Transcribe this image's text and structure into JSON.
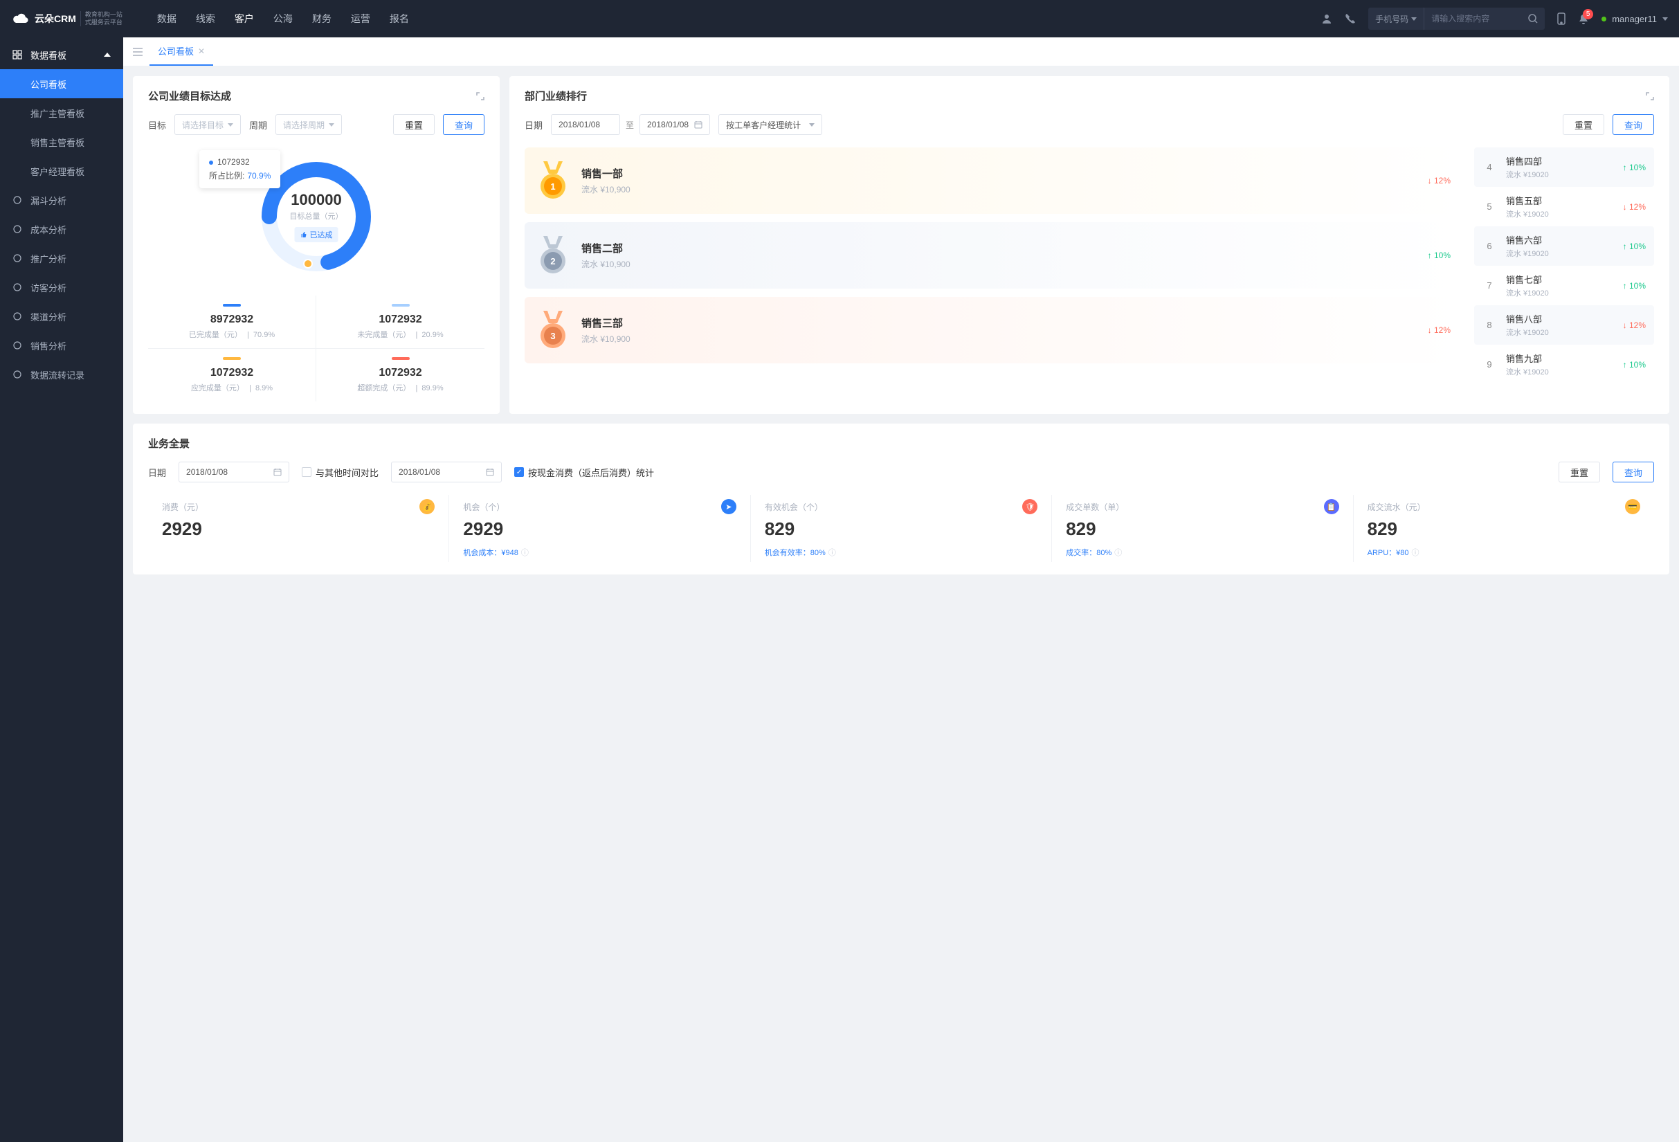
{
  "brand": {
    "name": "云朵CRM",
    "sub1": "教育机构一站",
    "sub2": "式服务云平台"
  },
  "nav": {
    "items": [
      "数据",
      "线索",
      "客户",
      "公海",
      "财务",
      "运营",
      "报名"
    ],
    "active_index": 2,
    "search_prefix": "手机号码",
    "search_placeholder": "请输入搜索内容",
    "notif_count": "5",
    "user": "manager11"
  },
  "sidebar": {
    "header": "数据看板",
    "subs": [
      "公司看板",
      "推广主管看板",
      "销售主管看板",
      "客户经理看板"
    ],
    "active_index": 0,
    "items": [
      "漏斗分析",
      "成本分析",
      "推广分析",
      "访客分析",
      "渠道分析",
      "销售分析",
      "数据流转记录"
    ]
  },
  "tab": {
    "title": "公司看板"
  },
  "goal": {
    "title": "公司业绩目标达成",
    "target_label": "目标",
    "target_placeholder": "请选择目标",
    "period_label": "周期",
    "period_placeholder": "请选择周期",
    "reset": "重置",
    "query": "查询",
    "tooltip_value": "1072932",
    "tooltip_ratio_label": "所占比例:",
    "tooltip_ratio": "70.9%",
    "center_num": "100000",
    "center_label": "目标总量（元）",
    "badge": "已达成",
    "metrics": [
      {
        "color": "#2d7ff9",
        "value": "8972932",
        "label": "已完成量（元）",
        "pct": "70.9%"
      },
      {
        "color": "#a6cfff",
        "value": "1072932",
        "label": "未完成量（元）",
        "pct": "20.9%"
      },
      {
        "color": "#ffb840",
        "value": "1072932",
        "label": "应完成量（元）",
        "pct": "8.9%"
      },
      {
        "color": "#ff6b5a",
        "value": "1072932",
        "label": "超额完成（元）",
        "pct": "89.9%"
      }
    ]
  },
  "ranking": {
    "title": "部门业绩排行",
    "date_label": "日期",
    "date_from": "2018/01/08",
    "date_to": "2018/01/08",
    "date_sep": "至",
    "stat_by": "按工单客户经理统计",
    "reset": "重置",
    "query": "查询",
    "top3": [
      {
        "name": "销售一部",
        "sub": "流水 ¥10,900",
        "trend": "down",
        "pct": "12%"
      },
      {
        "name": "销售二部",
        "sub": "流水 ¥10,900",
        "trend": "up",
        "pct": "10%"
      },
      {
        "name": "销售三部",
        "sub": "流水 ¥10,900",
        "trend": "down",
        "pct": "12%"
      }
    ],
    "rest": [
      {
        "idx": "4",
        "name": "销售四部",
        "sub": "流水 ¥19020",
        "trend": "up",
        "pct": "10%"
      },
      {
        "idx": "5",
        "name": "销售五部",
        "sub": "流水 ¥19020",
        "trend": "down",
        "pct": "12%"
      },
      {
        "idx": "6",
        "name": "销售六部",
        "sub": "流水 ¥19020",
        "trend": "up",
        "pct": "10%"
      },
      {
        "idx": "7",
        "name": "销售七部",
        "sub": "流水 ¥19020",
        "trend": "up",
        "pct": "10%"
      },
      {
        "idx": "8",
        "name": "销售八部",
        "sub": "流水 ¥19020",
        "trend": "down",
        "pct": "12%"
      },
      {
        "idx": "9",
        "name": "销售九部",
        "sub": "流水 ¥19020",
        "trend": "up",
        "pct": "10%"
      }
    ]
  },
  "overview": {
    "title": "业务全景",
    "date_label": "日期",
    "date1": "2018/01/08",
    "compare_label": "与其他时间对比",
    "date2": "2018/01/08",
    "consume_label": "按现金消费（返点后消费）统计",
    "reset": "重置",
    "query": "查询",
    "stats": [
      {
        "label": "消费（元）",
        "value": "2929",
        "foot": "",
        "color": "#ffb840"
      },
      {
        "label": "机会（个）",
        "value": "2929",
        "foot": "机会成本：¥948",
        "color": "#2d7ff9"
      },
      {
        "label": "有效机会（个）",
        "value": "829",
        "foot": "机会有效率：80%",
        "color": "#ff6b5a"
      },
      {
        "label": "成交单数（单）",
        "value": "829",
        "foot": "成交率：80%",
        "color": "#5b6cff"
      },
      {
        "label": "成交流水（元）",
        "value": "829",
        "foot": "ARPU：¥80",
        "color": "#ffb840"
      }
    ]
  },
  "chart_data": {
    "type": "pie",
    "title": "公司业绩目标达成",
    "total": 100000,
    "series": [
      {
        "name": "已完成量（元）",
        "value": 8972932,
        "pct": 70.9,
        "color": "#2d7ff9"
      },
      {
        "name": "未完成量（元）",
        "value": 1072932,
        "pct": 20.9,
        "color": "#a6cfff"
      },
      {
        "name": "应完成量（元）",
        "value": 1072932,
        "pct": 8.9,
        "color": "#ffb840"
      },
      {
        "name": "超额完成（元）",
        "value": 1072932,
        "pct": 89.9,
        "color": "#ff6b5a"
      }
    ]
  }
}
